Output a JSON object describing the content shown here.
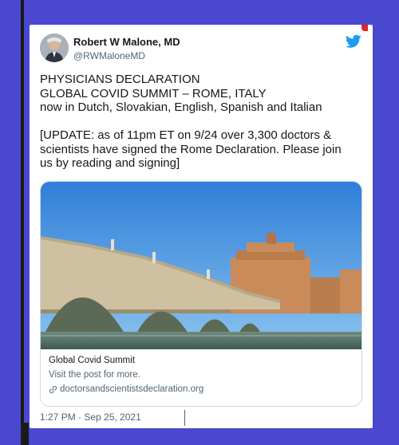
{
  "tweet": {
    "author_name": "Robert W Malone, MD",
    "author_handle": "@RWMaloneMD",
    "lines": [
      "PHYSICIANS DECLARATION",
      "GLOBAL COVID SUMMIT – ROME, ITALY",
      "now in Dutch, Slovakian, English, Spanish and Italian",
      "",
      "[UPDATE: as of 11pm ET on 9/24 over 3,300 doctors &",
      "scientists have signed the Rome Declaration. Please join",
      "us by reading and signing]"
    ],
    "timestamp": "1:27 PM · Sep 25, 2021"
  },
  "link_card": {
    "title": "Global Covid Summit",
    "description": "Visit the post for more.",
    "url": "doctorsandscientistsdeclaration.org"
  },
  "colors": {
    "background": "#4a48cf",
    "twitter_blue": "#1d9bf0",
    "text_primary": "#14171a",
    "text_secondary": "#536471"
  }
}
